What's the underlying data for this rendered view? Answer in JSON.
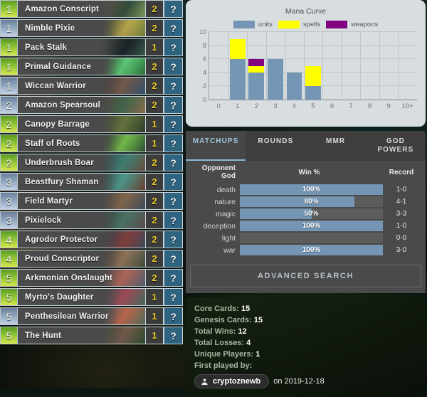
{
  "cards": [
    {
      "cost": "1",
      "name": "Amazon Conscript",
      "qty": "2",
      "marker": "?",
      "faction": "nature",
      "art": "linear-gradient(120deg,#6d5a44,#2d4b38 55%,#7f9a5a)"
    },
    {
      "cost": "1",
      "name": "Nimble Pixie",
      "qty": "2",
      "marker": "?",
      "faction": "magic",
      "art": "linear-gradient(120deg,#3c4a2c,#c8b44a 55%,#6a7a3a)"
    },
    {
      "cost": "1",
      "name": "Pack Stalk",
      "qty": "1",
      "marker": "?",
      "faction": "nature",
      "art": "linear-gradient(120deg,#2b3a2c,#121a22 55%,#3a5a4a)"
    },
    {
      "cost": "1",
      "name": "Primal Guidance",
      "qty": "2",
      "marker": "?",
      "faction": "nature",
      "art": "linear-gradient(120deg,#2e4a2e,#5fe07a 50%,#2a6a3a)"
    },
    {
      "cost": "1",
      "name": "Wiccan Warrior",
      "qty": "2",
      "marker": "?",
      "faction": "magic",
      "art": "linear-gradient(120deg,#4a3a2e,#7a5a4a 50%,#2f4f6a)"
    },
    {
      "cost": "2",
      "name": "Amazon Spearsoul",
      "qty": "2",
      "marker": "?",
      "faction": "magic",
      "art": "linear-gradient(120deg,#5a4a3a,#3f6a4a 50%,#8a6a4a)"
    },
    {
      "cost": "2",
      "name": "Canopy Barrage",
      "qty": "1",
      "marker": "?",
      "faction": "nature",
      "art": "linear-gradient(120deg,#3a4a2a,#6a7a3a 50%,#2a3a2a)"
    },
    {
      "cost": "2",
      "name": "Staff of Roots",
      "qty": "1",
      "marker": "?",
      "faction": "nature",
      "art": "linear-gradient(120deg,#2a3a28,#7ad04a 50%,#2a4a30)"
    },
    {
      "cost": "2",
      "name": "Underbrush Boar",
      "qty": "2",
      "marker": "?",
      "faction": "nature",
      "art": "linear-gradient(120deg,#2a4a52,#3a8a7a 50%,#6a4a3a)"
    },
    {
      "cost": "3",
      "name": "Beastfury Shaman",
      "qty": "2",
      "marker": "?",
      "faction": "magic",
      "art": "linear-gradient(120deg,#2a5a5a,#4aa89a 45%,#6a3a2a)"
    },
    {
      "cost": "3",
      "name": "Field Martyr",
      "qty": "2",
      "marker": "?",
      "faction": "magic",
      "art": "linear-gradient(120deg,#5a4a3a,#8a6a4a 50%,#3a4a5a)"
    },
    {
      "cost": "3",
      "name": "Pixielock",
      "qty": "2",
      "marker": "?",
      "faction": "magic",
      "art": "linear-gradient(120deg,#2a4a3a,#4a7a6a 50%,#5a4a4a)"
    },
    {
      "cost": "4",
      "name": "Agrodor Protector",
      "qty": "2",
      "marker": "?",
      "faction": "nature",
      "art": "linear-gradient(120deg,#2a3a4a,#8a3a3a 55%,#3a4a5a)"
    },
    {
      "cost": "4",
      "name": "Proud Conscriptor",
      "qty": "2",
      "marker": "?",
      "faction": "nature",
      "art": "linear-gradient(120deg,#4a3a2a,#9a7a5a 50%,#3a4a3a)"
    },
    {
      "cost": "5",
      "name": "Arkmonian Onslaught",
      "qty": "2",
      "marker": "?",
      "faction": "nature",
      "art": "linear-gradient(120deg,#6a4a4a,#c06a5a 50%,#4a5a6a)"
    },
    {
      "cost": "5",
      "name": "Myrto's Daughter",
      "qty": "1",
      "marker": "?",
      "faction": "nature",
      "art": "linear-gradient(120deg,#2a4a4a,#b04a5a 50%,#3a6a5a)"
    },
    {
      "cost": "5",
      "name": "Penthesilean Warrior",
      "qty": "1",
      "marker": "?",
      "faction": "magic",
      "art": "linear-gradient(120deg,#3a5a5a,#d06a4a 50%,#4a6a5a)"
    },
    {
      "cost": "5",
      "name": "The Hunt",
      "qty": "1",
      "marker": "?",
      "faction": "nature",
      "art": "linear-gradient(120deg,#3a4a2a,#7a5a4a 50%,#2a4a2a)"
    }
  ],
  "chart_data": {
    "type": "bar",
    "title": "Mana Curve",
    "xlabel": "",
    "ylabel": "",
    "stacked": true,
    "grid": true,
    "legend_position": "top",
    "categories": [
      "0",
      "1",
      "2",
      "3",
      "4",
      "5",
      "6",
      "7",
      "8",
      "9",
      "10+"
    ],
    "ylim": [
      0,
      10
    ],
    "yticks": [
      0,
      2,
      4,
      6,
      8,
      10
    ],
    "series": [
      {
        "name": "units",
        "color": "#7495b4",
        "values": [
          0,
          6,
          4,
          6,
          4,
          2,
          0,
          0,
          0,
          0,
          0
        ]
      },
      {
        "name": "spells",
        "color": "#ffff00",
        "values": [
          0,
          3,
          1,
          0,
          0,
          3,
          0,
          0,
          0,
          0,
          0
        ]
      },
      {
        "name": "weapons",
        "color": "#800080",
        "values": [
          0,
          0,
          1,
          0,
          0,
          0,
          0,
          0,
          0,
          0,
          0
        ]
      }
    ]
  },
  "tabs": [
    {
      "label": "MATCHUPS",
      "active": true
    },
    {
      "label": "ROUNDS",
      "active": false
    },
    {
      "label": "MMR",
      "active": false
    },
    {
      "label": "GOD POWERS",
      "active": false
    }
  ],
  "matchups": {
    "headers": {
      "god": "Opponent God",
      "win": "Win %",
      "record": "Record"
    },
    "rows": [
      {
        "god": "death",
        "pct": "100%",
        "value": 100,
        "record": "1-0"
      },
      {
        "god": "nature",
        "pct": "80%",
        "value": 80,
        "record": "4-1"
      },
      {
        "god": "magic",
        "pct": "50%",
        "value": 50,
        "record": "3-3"
      },
      {
        "god": "deception",
        "pct": "100%",
        "value": 100,
        "record": "1-0"
      },
      {
        "god": "light",
        "pct": "",
        "value": 0,
        "record": "0-0"
      },
      {
        "god": "war",
        "pct": "100%",
        "value": 100,
        "record": "3-0"
      }
    ]
  },
  "advanced_search_label": "ADVANCED SEARCH",
  "stats": {
    "core_cards_label": "Core Cards:",
    "core_cards": "15",
    "genesis_cards_label": "Genesis Cards:",
    "genesis_cards": "15",
    "total_wins_label": "Total Wins:",
    "total_wins": "12",
    "total_losses_label": "Total Losses:",
    "total_losses": "4",
    "unique_players_label": "Unique Players:",
    "unique_players": "1",
    "first_played_label": "First played by:",
    "username": "cryptoznewb",
    "played_date": "on 2019-12-18"
  },
  "colors": {
    "units": "#7495b4",
    "spells": "#ffff00",
    "weapons": "#800080",
    "accent": "#88b8d8",
    "qty": "#e8c92a",
    "marker_bg": "#2f6480"
  }
}
